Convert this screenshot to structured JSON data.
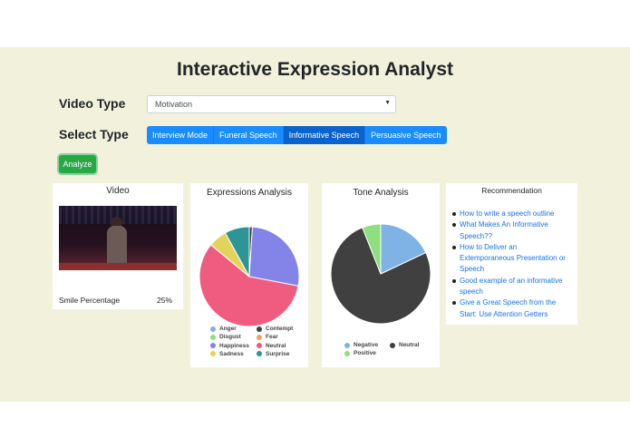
{
  "title": "Interactive Expression Analyst",
  "video_type": {
    "label": "Video Type",
    "selected": "Motivation"
  },
  "select_type": {
    "label": "Select Type",
    "options": [
      {
        "label": "Interview Mode",
        "active": false
      },
      {
        "label": "Funeral Speech",
        "active": false
      },
      {
        "label": "Informative Speech",
        "active": true
      },
      {
        "label": "Persuasive Speech",
        "active": false
      }
    ]
  },
  "analyze_label": "Analyze",
  "video_card": {
    "title": "Video",
    "smile_label": "Smile Percentage",
    "smile_value": "25%"
  },
  "expressions": {
    "title": "Expressions Analysis",
    "legend": [
      "Anger",
      "Contempt",
      "Disgust",
      "Fear",
      "Happiness",
      "Neutral",
      "Sadness",
      "Surprise"
    ]
  },
  "tone": {
    "title": "Tone Analysis",
    "legend": [
      "Negative",
      "Neutral",
      "Positive"
    ]
  },
  "recommendation": {
    "title": "Recommendation",
    "items": [
      "How to write a speech outline",
      "What Makes An Informative Speech??",
      "How to Deliver an Extemporaneous Presentation or Speech",
      "Good example of an informative speech",
      "Give a Great Speech from the Start: Use Attention Getters"
    ]
  },
  "chart_data": [
    {
      "type": "pie",
      "title": "Expressions Analysis",
      "labels": [
        "Anger",
        "Contempt",
        "Disgust",
        "Fear",
        "Happiness",
        "Neutral",
        "Sadness",
        "Surprise"
      ],
      "values": [
        0,
        1,
        0,
        0,
        27,
        58,
        6,
        8
      ],
      "colors": [
        "#7fb2e5",
        "#404040",
        "#8ee07e",
        "#f0a35a",
        "#8383e8",
        "#f05b80",
        "#e4d35a",
        "#2d9595"
      ]
    },
    {
      "type": "pie",
      "title": "Tone Analysis",
      "labels": [
        "Negative",
        "Neutral",
        "Positive"
      ],
      "values": [
        18,
        76,
        6
      ],
      "colors": [
        "#7fb2e5",
        "#404040",
        "#8ee07e"
      ]
    }
  ]
}
